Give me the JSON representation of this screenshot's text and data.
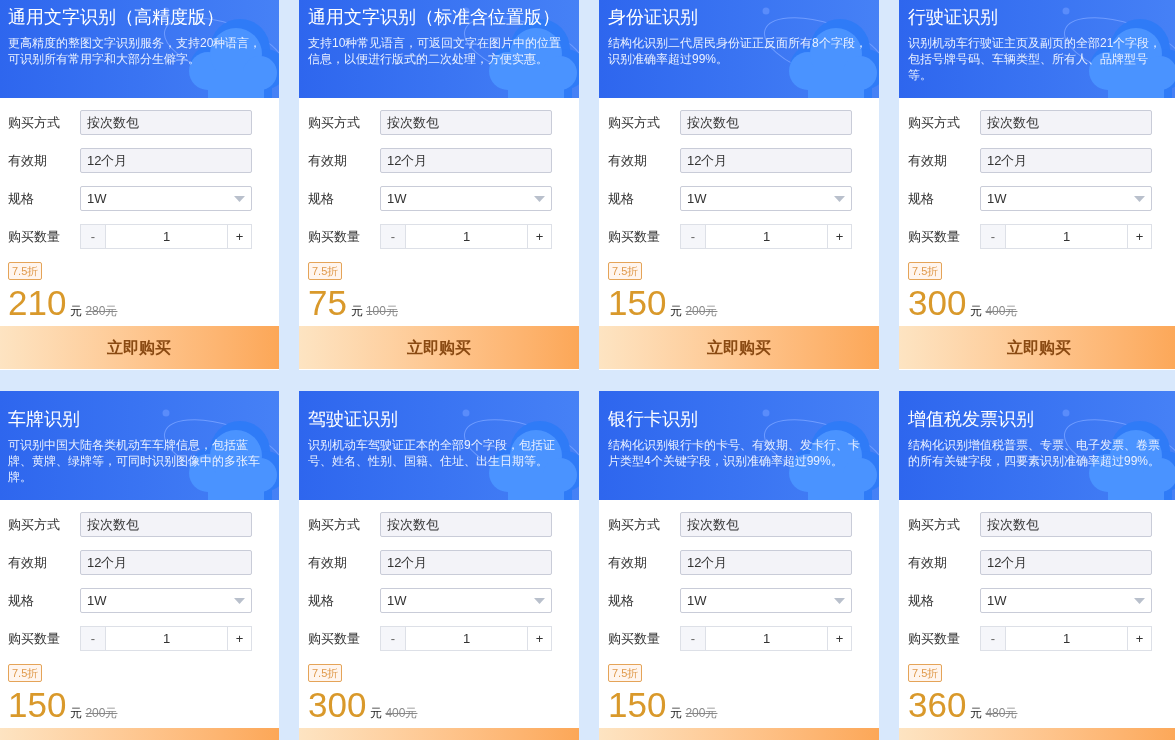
{
  "cards": [
    {
      "title": "通用文字识别（高精度版）",
      "description": "更高精度的整图文字识别服务，支持20种语言，可识别所有常用字和大部分生僻字。",
      "fields": [
        {
          "kind": "readonly",
          "label": "购买方式",
          "value": "按次数包"
        },
        {
          "kind": "readonly",
          "label": "有效期",
          "value": "12个月"
        },
        {
          "kind": "select",
          "label": "规格",
          "value": "1W"
        },
        {
          "kind": "stepper",
          "label": "购买数量",
          "decrement": "-",
          "value": "1",
          "increment": "+"
        }
      ],
      "discount": "7.5折",
      "price": "210",
      "unit": "元",
      "original_price": "280元",
      "button_label": "立即购买"
    },
    {
      "title": "通用文字识别（标准含位置版）",
      "description": "支持10种常见语言，可返回文字在图片中的位置信息，以便进行版式的二次处理，方便实惠。",
      "fields": [
        {
          "kind": "readonly",
          "label": "购买方式",
          "value": "按次数包"
        },
        {
          "kind": "readonly",
          "label": "有效期",
          "value": "12个月"
        },
        {
          "kind": "select",
          "label": "规格",
          "value": "1W"
        },
        {
          "kind": "stepper",
          "label": "购买数量",
          "decrement": "-",
          "value": "1",
          "increment": "+"
        }
      ],
      "discount": "7.5折",
      "price": "75",
      "unit": "元",
      "original_price": "100元",
      "button_label": "立即购买"
    },
    {
      "title": "身份证识别",
      "description": "结构化识别二代居民身份证正反面所有8个字段，识别准确率超过99%。",
      "fields": [
        {
          "kind": "readonly",
          "label": "购买方式",
          "value": "按次数包"
        },
        {
          "kind": "readonly",
          "label": "有效期",
          "value": "12个月"
        },
        {
          "kind": "select",
          "label": "规格",
          "value": "1W"
        },
        {
          "kind": "stepper",
          "label": "购买数量",
          "decrement": "-",
          "value": "1",
          "increment": "+"
        }
      ],
      "discount": "7.5折",
      "price": "150",
      "unit": "元",
      "original_price": "200元",
      "button_label": "立即购买"
    },
    {
      "title": "行驶证识别",
      "description": "识别机动车行驶证主页及副页的全部21个字段，包括号牌号码、车辆类型、所有人、品牌型号等。",
      "fields": [
        {
          "kind": "readonly",
          "label": "购买方式",
          "value": "按次数包"
        },
        {
          "kind": "readonly",
          "label": "有效期",
          "value": "12个月"
        },
        {
          "kind": "select",
          "label": "规格",
          "value": "1W"
        },
        {
          "kind": "stepper",
          "label": "购买数量",
          "decrement": "-",
          "value": "1",
          "increment": "+"
        }
      ],
      "discount": "7.5折",
      "price": "300",
      "unit": "元",
      "original_price": "400元",
      "button_label": "立即购买"
    },
    {
      "title": "车牌识别",
      "description": "可识别中国大陆各类机动车车牌信息，包括蓝牌、黄牌、绿牌等，可同时识别图像中的多张车牌。",
      "fields": [
        {
          "kind": "readonly",
          "label": "购买方式",
          "value": "按次数包"
        },
        {
          "kind": "readonly",
          "label": "有效期",
          "value": "12个月"
        },
        {
          "kind": "select",
          "label": "规格",
          "value": "1W"
        },
        {
          "kind": "stepper",
          "label": "购买数量",
          "decrement": "-",
          "value": "1",
          "increment": "+"
        }
      ],
      "discount": "7.5折",
      "price": "150",
      "unit": "元",
      "original_price": "200元"
    },
    {
      "title": "驾驶证识别",
      "description": "识别机动车驾驶证正本的全部9个字段，包括证号、姓名、性别、国籍、住址、出生日期等。",
      "fields": [
        {
          "kind": "readonly",
          "label": "购买方式",
          "value": "按次数包"
        },
        {
          "kind": "readonly",
          "label": "有效期",
          "value": "12个月"
        },
        {
          "kind": "select",
          "label": "规格",
          "value": "1W"
        },
        {
          "kind": "stepper",
          "label": "购买数量",
          "decrement": "-",
          "value": "1",
          "increment": "+"
        }
      ],
      "discount": "7.5折",
      "price": "300",
      "unit": "元",
      "original_price": "400元"
    },
    {
      "title": "银行卡识别",
      "description": "结构化识别银行卡的卡号、有效期、发卡行、卡片类型4个关键字段，识别准确率超过99%。",
      "fields": [
        {
          "kind": "readonly",
          "label": "购买方式",
          "value": "按次数包"
        },
        {
          "kind": "readonly",
          "label": "有效期",
          "value": "12个月"
        },
        {
          "kind": "select",
          "label": "规格",
          "value": "1W"
        },
        {
          "kind": "stepper",
          "label": "购买数量",
          "decrement": "-",
          "value": "1",
          "increment": "+"
        }
      ],
      "discount": "7.5折",
      "price": "150",
      "unit": "元",
      "original_price": "200元"
    },
    {
      "title": "增值税发票识别",
      "description": "结构化识别增值税普票、专票、电子发票、卷票的所有关键字段，四要素识别准确率超过99%。",
      "fields": [
        {
          "kind": "readonly",
          "label": "购买方式",
          "value": "按次数包"
        },
        {
          "kind": "readonly",
          "label": "有效期",
          "value": "12个月"
        },
        {
          "kind": "select",
          "label": "规格",
          "value": "1W"
        },
        {
          "kind": "stepper",
          "label": "购买数量",
          "decrement": "-",
          "value": "1",
          "increment": "+"
        }
      ],
      "discount": "7.5折",
      "price": "360",
      "unit": "元",
      "original_price": "480元"
    }
  ]
}
